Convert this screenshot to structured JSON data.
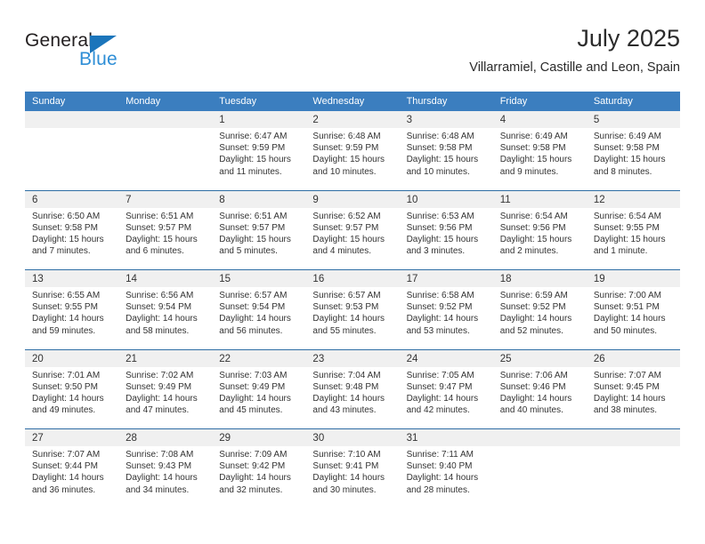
{
  "logo": {
    "word_one": "General",
    "word_two": "Blue",
    "triangle_icon": "triangle-icon",
    "brand_dark": "#231f20",
    "brand_blue": "#2e8ed6"
  },
  "header": {
    "title": "July 2025",
    "subtitle": "Villarramiel, Castille and Leon, Spain"
  },
  "theme": {
    "header_bar": "#3b7ebf",
    "row_divider": "#2e6da4",
    "day_band": "#f0f0f0"
  },
  "weekdays": [
    "Sunday",
    "Monday",
    "Tuesday",
    "Wednesday",
    "Thursday",
    "Friday",
    "Saturday"
  ],
  "weeks": [
    [
      {
        "day": "",
        "sunrise": "",
        "sunset": "",
        "daylight_a": "",
        "daylight_b": ""
      },
      {
        "day": "",
        "sunrise": "",
        "sunset": "",
        "daylight_a": "",
        "daylight_b": ""
      },
      {
        "day": "1",
        "sunrise": "Sunrise: 6:47 AM",
        "sunset": "Sunset: 9:59 PM",
        "daylight_a": "Daylight: 15 hours",
        "daylight_b": "and 11 minutes."
      },
      {
        "day": "2",
        "sunrise": "Sunrise: 6:48 AM",
        "sunset": "Sunset: 9:59 PM",
        "daylight_a": "Daylight: 15 hours",
        "daylight_b": "and 10 minutes."
      },
      {
        "day": "3",
        "sunrise": "Sunrise: 6:48 AM",
        "sunset": "Sunset: 9:58 PM",
        "daylight_a": "Daylight: 15 hours",
        "daylight_b": "and 10 minutes."
      },
      {
        "day": "4",
        "sunrise": "Sunrise: 6:49 AM",
        "sunset": "Sunset: 9:58 PM",
        "daylight_a": "Daylight: 15 hours",
        "daylight_b": "and 9 minutes."
      },
      {
        "day": "5",
        "sunrise": "Sunrise: 6:49 AM",
        "sunset": "Sunset: 9:58 PM",
        "daylight_a": "Daylight: 15 hours",
        "daylight_b": "and 8 minutes."
      }
    ],
    [
      {
        "day": "6",
        "sunrise": "Sunrise: 6:50 AM",
        "sunset": "Sunset: 9:58 PM",
        "daylight_a": "Daylight: 15 hours",
        "daylight_b": "and 7 minutes."
      },
      {
        "day": "7",
        "sunrise": "Sunrise: 6:51 AM",
        "sunset": "Sunset: 9:57 PM",
        "daylight_a": "Daylight: 15 hours",
        "daylight_b": "and 6 minutes."
      },
      {
        "day": "8",
        "sunrise": "Sunrise: 6:51 AM",
        "sunset": "Sunset: 9:57 PM",
        "daylight_a": "Daylight: 15 hours",
        "daylight_b": "and 5 minutes."
      },
      {
        "day": "9",
        "sunrise": "Sunrise: 6:52 AM",
        "sunset": "Sunset: 9:57 PM",
        "daylight_a": "Daylight: 15 hours",
        "daylight_b": "and 4 minutes."
      },
      {
        "day": "10",
        "sunrise": "Sunrise: 6:53 AM",
        "sunset": "Sunset: 9:56 PM",
        "daylight_a": "Daylight: 15 hours",
        "daylight_b": "and 3 minutes."
      },
      {
        "day": "11",
        "sunrise": "Sunrise: 6:54 AM",
        "sunset": "Sunset: 9:56 PM",
        "daylight_a": "Daylight: 15 hours",
        "daylight_b": "and 2 minutes."
      },
      {
        "day": "12",
        "sunrise": "Sunrise: 6:54 AM",
        "sunset": "Sunset: 9:55 PM",
        "daylight_a": "Daylight: 15 hours",
        "daylight_b": "and 1 minute."
      }
    ],
    [
      {
        "day": "13",
        "sunrise": "Sunrise: 6:55 AM",
        "sunset": "Sunset: 9:55 PM",
        "daylight_a": "Daylight: 14 hours",
        "daylight_b": "and 59 minutes."
      },
      {
        "day": "14",
        "sunrise": "Sunrise: 6:56 AM",
        "sunset": "Sunset: 9:54 PM",
        "daylight_a": "Daylight: 14 hours",
        "daylight_b": "and 58 minutes."
      },
      {
        "day": "15",
        "sunrise": "Sunrise: 6:57 AM",
        "sunset": "Sunset: 9:54 PM",
        "daylight_a": "Daylight: 14 hours",
        "daylight_b": "and 56 minutes."
      },
      {
        "day": "16",
        "sunrise": "Sunrise: 6:57 AM",
        "sunset": "Sunset: 9:53 PM",
        "daylight_a": "Daylight: 14 hours",
        "daylight_b": "and 55 minutes."
      },
      {
        "day": "17",
        "sunrise": "Sunrise: 6:58 AM",
        "sunset": "Sunset: 9:52 PM",
        "daylight_a": "Daylight: 14 hours",
        "daylight_b": "and 53 minutes."
      },
      {
        "day": "18",
        "sunrise": "Sunrise: 6:59 AM",
        "sunset": "Sunset: 9:52 PM",
        "daylight_a": "Daylight: 14 hours",
        "daylight_b": "and 52 minutes."
      },
      {
        "day": "19",
        "sunrise": "Sunrise: 7:00 AM",
        "sunset": "Sunset: 9:51 PM",
        "daylight_a": "Daylight: 14 hours",
        "daylight_b": "and 50 minutes."
      }
    ],
    [
      {
        "day": "20",
        "sunrise": "Sunrise: 7:01 AM",
        "sunset": "Sunset: 9:50 PM",
        "daylight_a": "Daylight: 14 hours",
        "daylight_b": "and 49 minutes."
      },
      {
        "day": "21",
        "sunrise": "Sunrise: 7:02 AM",
        "sunset": "Sunset: 9:49 PM",
        "daylight_a": "Daylight: 14 hours",
        "daylight_b": "and 47 minutes."
      },
      {
        "day": "22",
        "sunrise": "Sunrise: 7:03 AM",
        "sunset": "Sunset: 9:49 PM",
        "daylight_a": "Daylight: 14 hours",
        "daylight_b": "and 45 minutes."
      },
      {
        "day": "23",
        "sunrise": "Sunrise: 7:04 AM",
        "sunset": "Sunset: 9:48 PM",
        "daylight_a": "Daylight: 14 hours",
        "daylight_b": "and 43 minutes."
      },
      {
        "day": "24",
        "sunrise": "Sunrise: 7:05 AM",
        "sunset": "Sunset: 9:47 PM",
        "daylight_a": "Daylight: 14 hours",
        "daylight_b": "and 42 minutes."
      },
      {
        "day": "25",
        "sunrise": "Sunrise: 7:06 AM",
        "sunset": "Sunset: 9:46 PM",
        "daylight_a": "Daylight: 14 hours",
        "daylight_b": "and 40 minutes."
      },
      {
        "day": "26",
        "sunrise": "Sunrise: 7:07 AM",
        "sunset": "Sunset: 9:45 PM",
        "daylight_a": "Daylight: 14 hours",
        "daylight_b": "and 38 minutes."
      }
    ],
    [
      {
        "day": "27",
        "sunrise": "Sunrise: 7:07 AM",
        "sunset": "Sunset: 9:44 PM",
        "daylight_a": "Daylight: 14 hours",
        "daylight_b": "and 36 minutes."
      },
      {
        "day": "28",
        "sunrise": "Sunrise: 7:08 AM",
        "sunset": "Sunset: 9:43 PM",
        "daylight_a": "Daylight: 14 hours",
        "daylight_b": "and 34 minutes."
      },
      {
        "day": "29",
        "sunrise": "Sunrise: 7:09 AM",
        "sunset": "Sunset: 9:42 PM",
        "daylight_a": "Daylight: 14 hours",
        "daylight_b": "and 32 minutes."
      },
      {
        "day": "30",
        "sunrise": "Sunrise: 7:10 AM",
        "sunset": "Sunset: 9:41 PM",
        "daylight_a": "Daylight: 14 hours",
        "daylight_b": "and 30 minutes."
      },
      {
        "day": "31",
        "sunrise": "Sunrise: 7:11 AM",
        "sunset": "Sunset: 9:40 PM",
        "daylight_a": "Daylight: 14 hours",
        "daylight_b": "and 28 minutes."
      },
      {
        "day": "",
        "sunrise": "",
        "sunset": "",
        "daylight_a": "",
        "daylight_b": ""
      },
      {
        "day": "",
        "sunrise": "",
        "sunset": "",
        "daylight_a": "",
        "daylight_b": ""
      }
    ]
  ]
}
